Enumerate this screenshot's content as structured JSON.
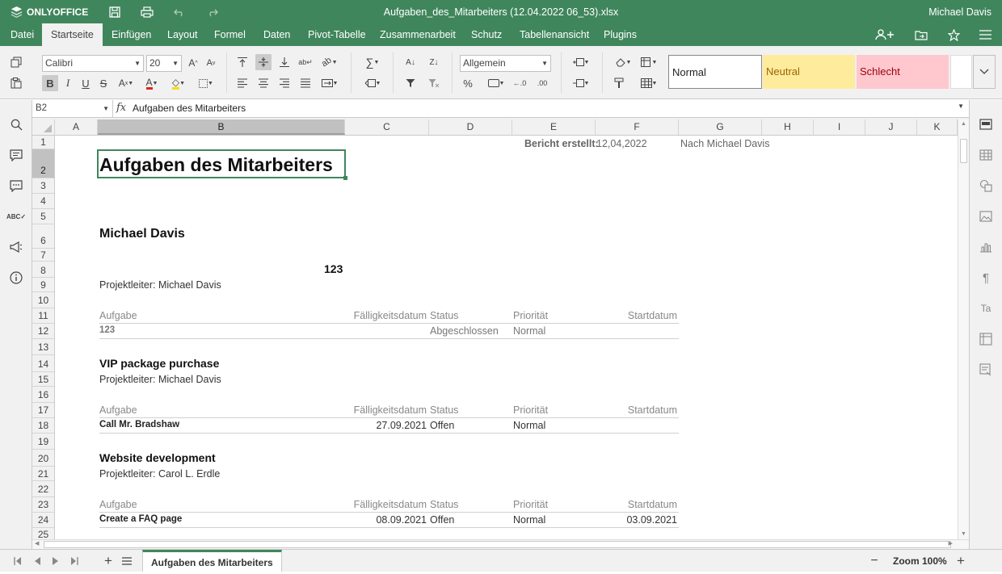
{
  "app": {
    "brand": "ONLYOFFICE",
    "document_title": "Aufgaben_des_Mitarbeiters (12.04.2022 06_53).xlsx",
    "user": "Michael Davis"
  },
  "menu_tabs": [
    "Datei",
    "Startseite",
    "Einfügen",
    "Layout",
    "Formel",
    "Daten",
    "Pivot-Tabelle",
    "Zusammenarbeit",
    "Schutz",
    "Tabellenansicht",
    "Plugins"
  ],
  "toolbar": {
    "font_name": "Calibri",
    "font_size": "20",
    "number_format": "Allgemein",
    "styles": {
      "normal": "Normal",
      "neutral": "Neutral",
      "bad": "Schlecht"
    }
  },
  "formula_bar": {
    "cell_ref": "B2",
    "fx": "fx",
    "value": "Aufgaben des Mitarbeiters"
  },
  "columns": [
    "A",
    "B",
    "C",
    "D",
    "E",
    "F",
    "G",
    "H",
    "I",
    "J",
    "K"
  ],
  "rows": [
    "1",
    "2",
    "3",
    "4",
    "5",
    "6",
    "7",
    "8",
    "9",
    "10",
    "11",
    "12",
    "13",
    "14",
    "15",
    "16",
    "17",
    "18",
    "19",
    "20",
    "21",
    "22",
    "23",
    "24",
    "25"
  ],
  "sheet": {
    "report_label": "Bericht erstellt:",
    "report_date": "12,04,2022",
    "report_by": "Nach Michael Davis",
    "title": "Aufgaben des Mitarbeiters",
    "employee": "Michael Davis",
    "employee_id": "123",
    "headers": {
      "task": "Aufgabe",
      "due": "Fälligkeitsdatum",
      "status": "Status",
      "priority": "Priorität",
      "start": "Startdatum"
    },
    "projects": [
      {
        "name": "",
        "lead": "Projektleiter: Michael Davis",
        "task": "123",
        "due": "",
        "status": "Abgeschlossen",
        "priority": "Normal",
        "start": ""
      },
      {
        "name": "VIP package purchase",
        "lead": "Projektleiter: Michael Davis",
        "task": "Call Mr. Bradshaw",
        "due": "27.09.2021",
        "status": "Offen",
        "priority": "Normal",
        "start": ""
      },
      {
        "name": "Website development",
        "lead": "Projektleiter: Carol L. Erdle",
        "task": "Create a FAQ page",
        "due": "08.09.2021",
        "status": "Offen",
        "priority": "Normal",
        "start": "03.09.2021"
      }
    ]
  },
  "status_bar": {
    "sheet_tab": "Aufgaben des Mitarbeiters",
    "zoom": "Zoom 100%"
  },
  "colors": {
    "accent": "#40865c",
    "neutral_bg": "#ffeb9c",
    "neutral_fg": "#9c6500",
    "bad_bg": "#ffc7ce",
    "bad_fg": "#9c0006"
  }
}
